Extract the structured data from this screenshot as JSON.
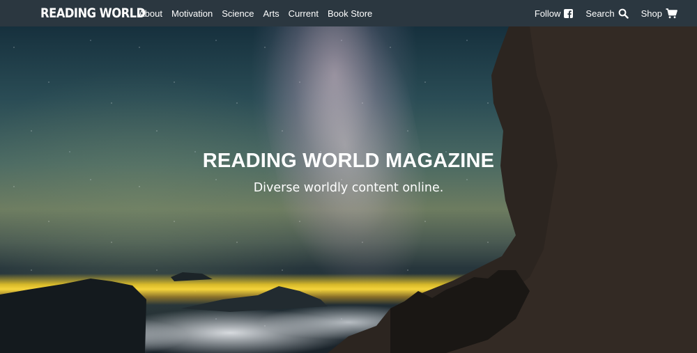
{
  "navbar": {
    "brand": "READING WORLD",
    "links": [
      "About",
      "Motivation",
      "Science",
      "Arts",
      "Current",
      "Book Store"
    ],
    "follow_label": "Follow",
    "search_label": "Search",
    "shop_label": "Shop",
    "icons": {
      "follow": "facebook-icon",
      "search": "search-icon",
      "shop": "cart-icon"
    },
    "background_color": "#2b3740"
  },
  "hero": {
    "title": "READING WORLD MAGAZINE",
    "subtitle": "Diverse worldly content online."
  }
}
